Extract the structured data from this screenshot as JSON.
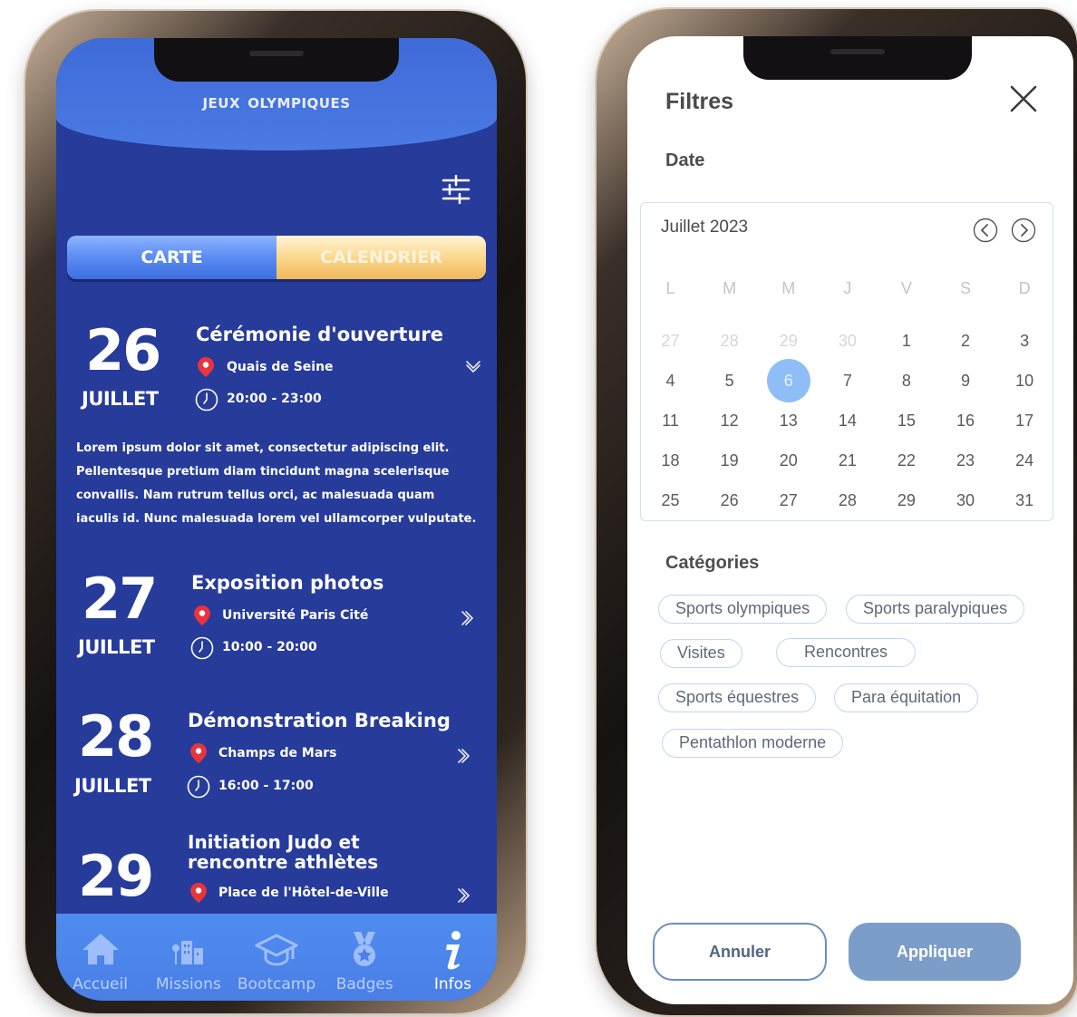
{
  "left_app": {
    "title": "Jeux olympiques",
    "tabs": {
      "map": "CARTE",
      "calendar": "CALENDRIER"
    },
    "events": [
      {
        "day": "26",
        "month": "JUILLET",
        "title": "Cérémonie d'ouverture",
        "place": "Quais de Seine",
        "time": "20:00 - 23:00",
        "expanded": true,
        "description": "Lorem ipsum dolor sit amet, consectetur adipiscing elit. Pellentesque pretium diam tincidunt magna scelerisque convallis. Nam rutrum tellus orci, ac malesuada quam iaculis id. Nunc malesuada lorem vel ullamcorper vulputate."
      },
      {
        "day": "27",
        "month": "JUILLET",
        "title": "Exposition photos",
        "place": "Université Paris Cité",
        "time": "10:00 - 20:00"
      },
      {
        "day": "28",
        "month": "JUILLET",
        "title": "Démonstration Breaking",
        "place": "Champs de Mars",
        "time": "16:00 - 17:00"
      },
      {
        "day": "29",
        "month": "",
        "title_line1": "Initiation Judo et",
        "title_line2": "rencontre athlètes",
        "place": "Place de l'Hôtel-de-Ville",
        "time": ""
      }
    ],
    "nav": [
      {
        "label": "Accueil",
        "icon": "home-icon"
      },
      {
        "label": "Missions",
        "icon": "city-icon"
      },
      {
        "label": "Bootcamp",
        "icon": "graduation-cap-icon"
      },
      {
        "label": "Badges",
        "icon": "medal-icon"
      },
      {
        "label": "Infos",
        "icon": "info-icon"
      }
    ],
    "colors": {
      "background": "#263b9a",
      "header": "#4b7ae4",
      "pin": "#e8343c",
      "calendar_tab": "#f0b85c"
    }
  },
  "filters": {
    "title": "Filtres",
    "date_label": "Date",
    "calendar": {
      "month": "Juillet 2023",
      "weekdays": [
        "L",
        "M",
        "M",
        "J",
        "V",
        "S",
        "D"
      ],
      "weeks": [
        [
          "27",
          "28",
          "29",
          "30",
          "1",
          "2",
          "3"
        ],
        [
          "4",
          "5",
          "6",
          "7",
          "8",
          "9",
          "10"
        ],
        [
          "11",
          "12",
          "13",
          "14",
          "15",
          "16",
          "17"
        ],
        [
          "18",
          "19",
          "20",
          "21",
          "22",
          "23",
          "24"
        ],
        [
          "25",
          "26",
          "27",
          "28",
          "29",
          "30",
          "31"
        ]
      ],
      "selected": "6"
    },
    "categories_label": "Catégories",
    "categories": [
      "Sports olympiques",
      "Sports paralypiques",
      "Visites",
      "Rencontres",
      "Sports équestres",
      "Para équitation",
      "Pentathlon moderne"
    ],
    "cancel": "Annuler",
    "apply": "Appliquer",
    "colors": {
      "accent": "#7c9dc7",
      "selected_day": "#8fbdf6",
      "chip_border": "#bfd6f4"
    }
  }
}
